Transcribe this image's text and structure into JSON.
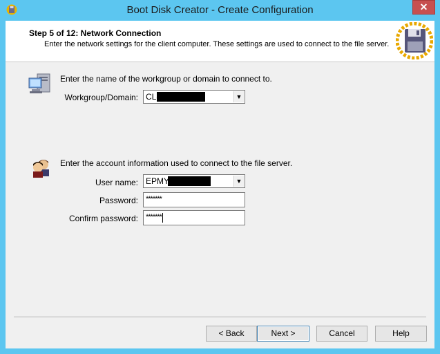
{
  "window": {
    "title": "Boot Disk Creator - Create Configuration",
    "close_glyph": "✕"
  },
  "header": {
    "step_title": "Step 5 of 12: Network Connection",
    "step_desc": "Enter the network settings for the client computer.  These settings are used to connect to the file server."
  },
  "workgroup": {
    "instruction": "Enter the name of the workgroup or domain to connect to.",
    "label": "Workgroup/Domain:",
    "value": "CL-"
  },
  "account": {
    "instruction": "Enter the account information used to connect to the file server.",
    "username_label": "User name:",
    "username_value": "EPMY",
    "password_label": "Password:",
    "password_value": "*******",
    "confirm_label": "Confirm password:",
    "confirm_value": "*******"
  },
  "buttons": {
    "back": "< Back",
    "next": "Next >",
    "cancel": "Cancel",
    "help": "Help"
  },
  "icons": {
    "app": "floppy-disk-icon",
    "header": "floppy-disk-icon",
    "network": "network-computer-icon",
    "users": "users-icon",
    "dropdown": "chevron-down-icon"
  }
}
